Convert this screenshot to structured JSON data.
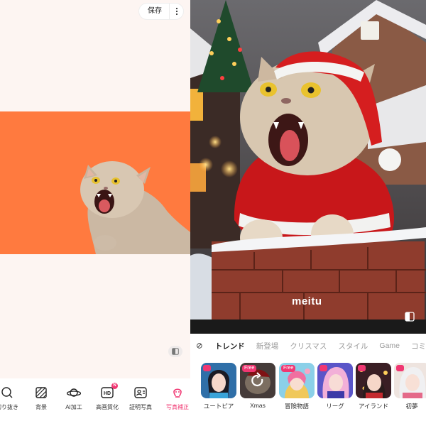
{
  "left": {
    "save_label": "保存",
    "tools": [
      {
        "label": "切り抜き",
        "icon": "cutout-icon"
      },
      {
        "label": "背景",
        "icon": "background-icon"
      },
      {
        "label": "AI加工",
        "icon": "ai-planet-icon"
      },
      {
        "label": "高画質化",
        "icon": "hd-icon",
        "badge": "N"
      },
      {
        "label": "証明写真",
        "icon": "id-photo-icon"
      },
      {
        "label": "写真補正",
        "icon": "retouch-icon",
        "active": true
      }
    ],
    "canvas_background": "#ff7a3f",
    "accent": "#f03772"
  },
  "right": {
    "watermark": "meitu",
    "tabs": [
      "トレンド",
      "新登場",
      "クリスマス",
      "スタイル",
      "Game",
      "コミ"
    ],
    "active_tab": "トレンド",
    "styles": [
      {
        "label": "ユートピア",
        "tag": ""
      },
      {
        "label": "Xmas",
        "tag": "Free"
      },
      {
        "label": "冒険物語",
        "tag": "Free"
      },
      {
        "label": "リーグ",
        "tag": ""
      },
      {
        "label": "アイランド",
        "tag": ""
      },
      {
        "label": "初夢",
        "tag": ""
      }
    ]
  }
}
